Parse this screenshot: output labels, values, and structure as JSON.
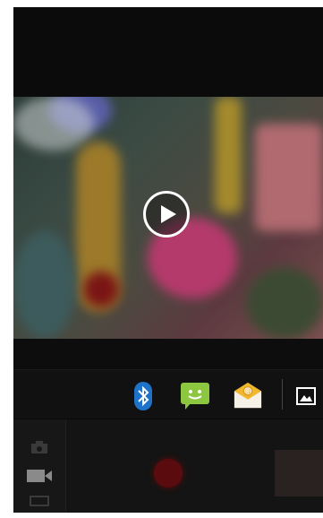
{
  "colors": {
    "background": "#0a0a0a",
    "record_button": "#5a0b0d",
    "message_green": "#8dc63f",
    "bluetooth_blue": "#1e73c8",
    "email_yellow": "#f0b72f"
  },
  "preview": {
    "play_icon": "play-icon"
  },
  "share_bar": {
    "items": [
      {
        "name": "bluetooth-icon"
      },
      {
        "name": "messaging-icon"
      },
      {
        "name": "email-icon"
      },
      {
        "name": "gallery-icon"
      }
    ]
  },
  "controls": {
    "modes": [
      "camera-icon",
      "video-camera-icon",
      "panorama-icon"
    ],
    "record_icon": "record-button",
    "thumbnail": "last-capture-thumbnail"
  }
}
